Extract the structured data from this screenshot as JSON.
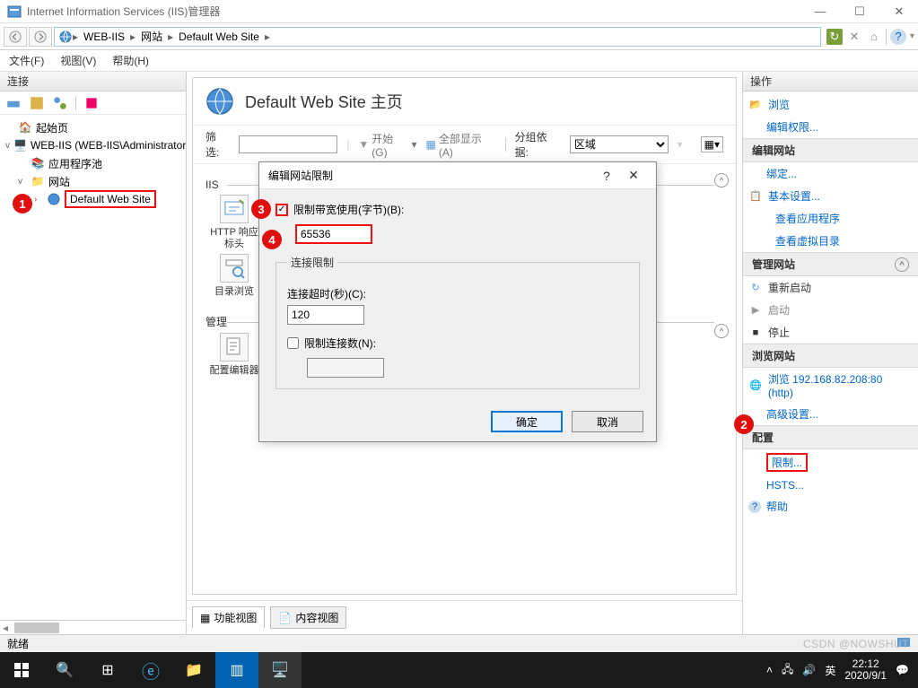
{
  "window": {
    "title": "Internet Information Services (IIS)管理器"
  },
  "breadcrumb": {
    "items": [
      "WEB-IIS",
      "网站",
      "Default Web Site"
    ]
  },
  "menubar": [
    "文件(F)",
    "视图(V)",
    "帮助(H)"
  ],
  "left_panel": {
    "header": "连接"
  },
  "tree": {
    "root": "起始页",
    "server": "WEB-IIS (WEB-IIS\\Administrator)",
    "apppool": "应用程序池",
    "sites": "网站",
    "default_site": "Default Web Site"
  },
  "center": {
    "title": "Default Web Site 主页",
    "filter_label": "筛选:",
    "start": "开始(G)",
    "showall": "全部显示(A)",
    "group_label": "分组依据:",
    "group_value": "区域",
    "groups": {
      "iis": "IIS",
      "management": "管理"
    },
    "tiles": {
      "http_headers": "HTTP 响应标头",
      "dir_browse": "目录浏览",
      "config_editor": "配置编辑器"
    },
    "tabs": {
      "features": "功能视图",
      "content": "内容视图"
    }
  },
  "dialog": {
    "title": "编辑网站限制",
    "bandwidth_check": "限制带宽使用(字节)(B):",
    "bandwidth_value": "65536",
    "fieldset": "连接限制",
    "timeout_label": "连接超时(秒)(C):",
    "timeout_value": "120",
    "maxconn_label": "限制连接数(N):",
    "maxconn_value": "",
    "ok": "确定",
    "cancel": "取消"
  },
  "actions": {
    "header": "操作",
    "browse": "浏览",
    "edit_perm": "编辑权限...",
    "section_editsite": "编辑网站",
    "bindings": "绑定...",
    "basic": "基本设置...",
    "view_apps": "查看应用程序",
    "view_vdir": "查看虚拟目录",
    "section_manage": "管理网站",
    "restart": "重新启动",
    "start": "启动",
    "stop": "停止",
    "section_browse": "浏览网站",
    "browse_url": "浏览 192.168.82.208:80 (http)",
    "advanced": "高级设置...",
    "section_config": "配置",
    "limits": "限制...",
    "hsts": "HSTS...",
    "help": "帮助"
  },
  "statusbar": {
    "ready": "就绪"
  },
  "taskbar": {
    "lang": "英",
    "time": "22:12",
    "date": "2020/9/1"
  },
  "watermark": "CSDN @NOWSHUT",
  "badges": [
    "1",
    "2",
    "3",
    "4"
  ]
}
